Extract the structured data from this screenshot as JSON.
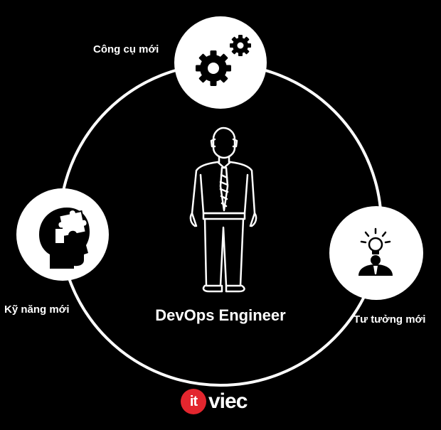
{
  "labels": {
    "tools": "Công cụ mới",
    "skills": "Kỹ năng mới",
    "mindset": "Tư tưởng mới",
    "center": "DevOps Engineer"
  },
  "logo": {
    "badge": "it",
    "text": "viec"
  },
  "icons": {
    "tools": "gears-icon",
    "skills": "head-puzzle-icon",
    "mindset": "lightbulb-person-icon",
    "center": "engineer-person-icon"
  },
  "colors": {
    "background": "#000000",
    "foreground": "#ffffff",
    "brand": "#e3262e"
  }
}
